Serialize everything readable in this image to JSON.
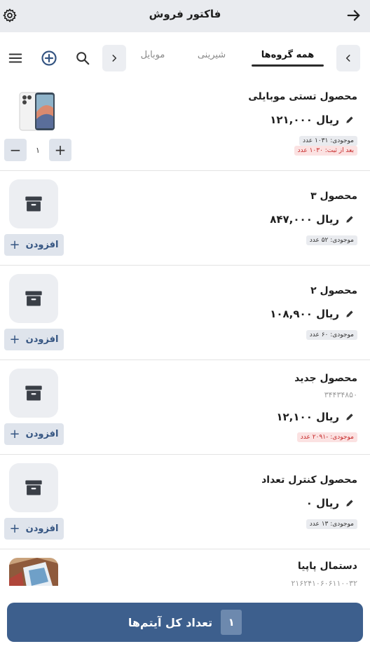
{
  "header": {
    "title": "فاکتور فروش",
    "back_icon": "arrow-right-icon",
    "settings_icon": "gear-icon"
  },
  "tabs": {
    "items": [
      {
        "label": "همه گروه‌ها",
        "active": true
      },
      {
        "label": "شیرینی",
        "active": false
      },
      {
        "label": "موبایل",
        "active": false
      }
    ],
    "icons": [
      "chevron-left-icon",
      "chevron-right-icon",
      "search-icon",
      "add-circle-icon",
      "menu-icon"
    ]
  },
  "products": [
    {
      "name": "محصول تستی موبایلی",
      "price": "۱۲۱,۰۰۰ ریال",
      "stock": "موجودی: ۱۰۳۱ عدد",
      "after_register": "بعد از ثبت: ۱۰۳۰ عدد",
      "quantity": "۱",
      "image": "phone-image"
    },
    {
      "name": "محصول ۳",
      "price": "۸۴۷,۰۰۰ ریال",
      "stock": "موجودی: ۵۲ عدد",
      "add_label": "افزودن"
    },
    {
      "name": "محصول ۲",
      "price": "۱۰۸,۹۰۰ ریال",
      "stock": "موجودی: ۶۰ عدد",
      "add_label": "افزودن"
    },
    {
      "name": "محصول جدید",
      "code": "۳۴۴۳۴۸۵۰",
      "price": "۱۲,۱۰۰ ریال",
      "stock": "موجودی: -۲۰۹۱ عدد",
      "add_label": "افزودن"
    },
    {
      "name": "محصول کنترل تعداد",
      "price": "۰ ریال",
      "stock": "موجودی: ۱۳ عدد",
      "add_label": "افزودن"
    },
    {
      "name": "دستمال پاپیا",
      "code": "۲۱۶۲۴۱۰۶۰۶۱۱۰۰۳۲",
      "image": "towel-image"
    }
  ],
  "footer": {
    "count": "۱",
    "label": "تعداد کل آیتم‌ها"
  },
  "colors": {
    "primary": "#3d5f8d",
    "topbar": "#e9ebef",
    "negative": "#c62828"
  }
}
